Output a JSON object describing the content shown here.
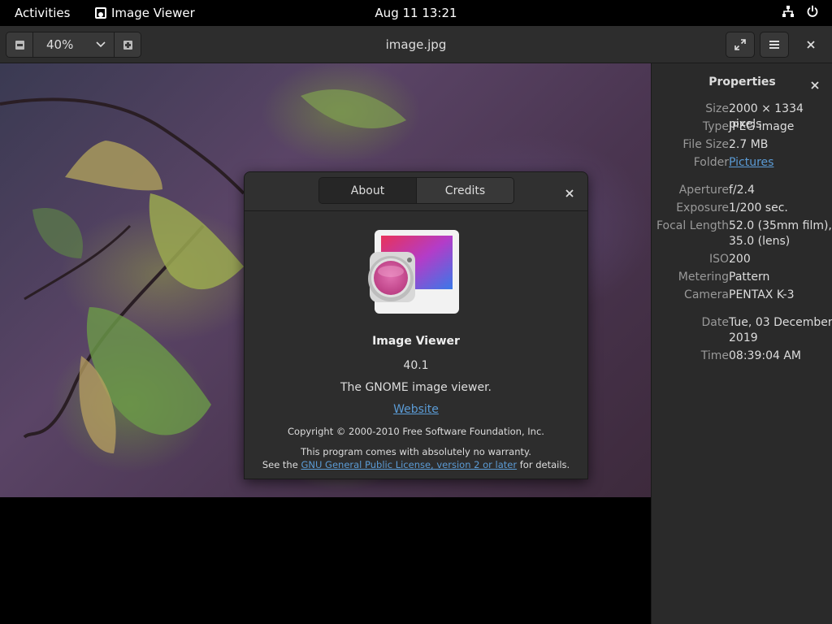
{
  "topbar": {
    "activities": "Activities",
    "app_name": "Image Viewer",
    "clock": "Aug 11  13:21"
  },
  "headerbar": {
    "zoom": "40%",
    "title": "image.jpg"
  },
  "sidebar": {
    "title": "Properties",
    "props": [
      {
        "key": "Size",
        "value": "2000 × 1334 pixels"
      },
      {
        "key": "Type",
        "value": "JPEG image"
      },
      {
        "key": "File Size",
        "value": "2.7 MB"
      },
      {
        "key": "Folder",
        "value": "Pictures"
      },
      {
        "key": "Aperture",
        "value": "f/2.4"
      },
      {
        "key": "Exposure",
        "value": "1/200 sec."
      },
      {
        "key": "Focal Length",
        "value": "52.0 (35mm film), 35.0 (lens)"
      },
      {
        "key": "ISO",
        "value": "200"
      },
      {
        "key": "Metering",
        "value": "Pattern"
      },
      {
        "key": "Camera",
        "value": "PENTAX K-3"
      },
      {
        "key": "Date",
        "value": "Tue, 03 December 2019"
      },
      {
        "key": "Time",
        "value": "08:39:04 AM"
      }
    ]
  },
  "about": {
    "tabs": [
      "About",
      "Credits"
    ],
    "app_name": "Image Viewer",
    "version": "40.1",
    "comment": "The GNOME image viewer.",
    "website": "Website",
    "copyright": "Copyright © 2000-2010 Free Software Foundation, Inc.",
    "warranty_line1": "This program comes with absolutely no warranty.",
    "warranty_prefix": "See the ",
    "license_link": "GNU General Public License, version 2 or later",
    "warranty_suffix": " for details."
  },
  "colors": {
    "accent_link": "#5b9bd5",
    "panel_bg": "#2d2d2d",
    "sidebar_bg": "#2a2a2a"
  },
  "icons": [
    "app-icon",
    "network-icon",
    "power-icon",
    "zoom-out-icon",
    "chevron-down-icon",
    "zoom-in-icon",
    "fullscreen-icon",
    "menu-icon",
    "close-icon"
  ]
}
